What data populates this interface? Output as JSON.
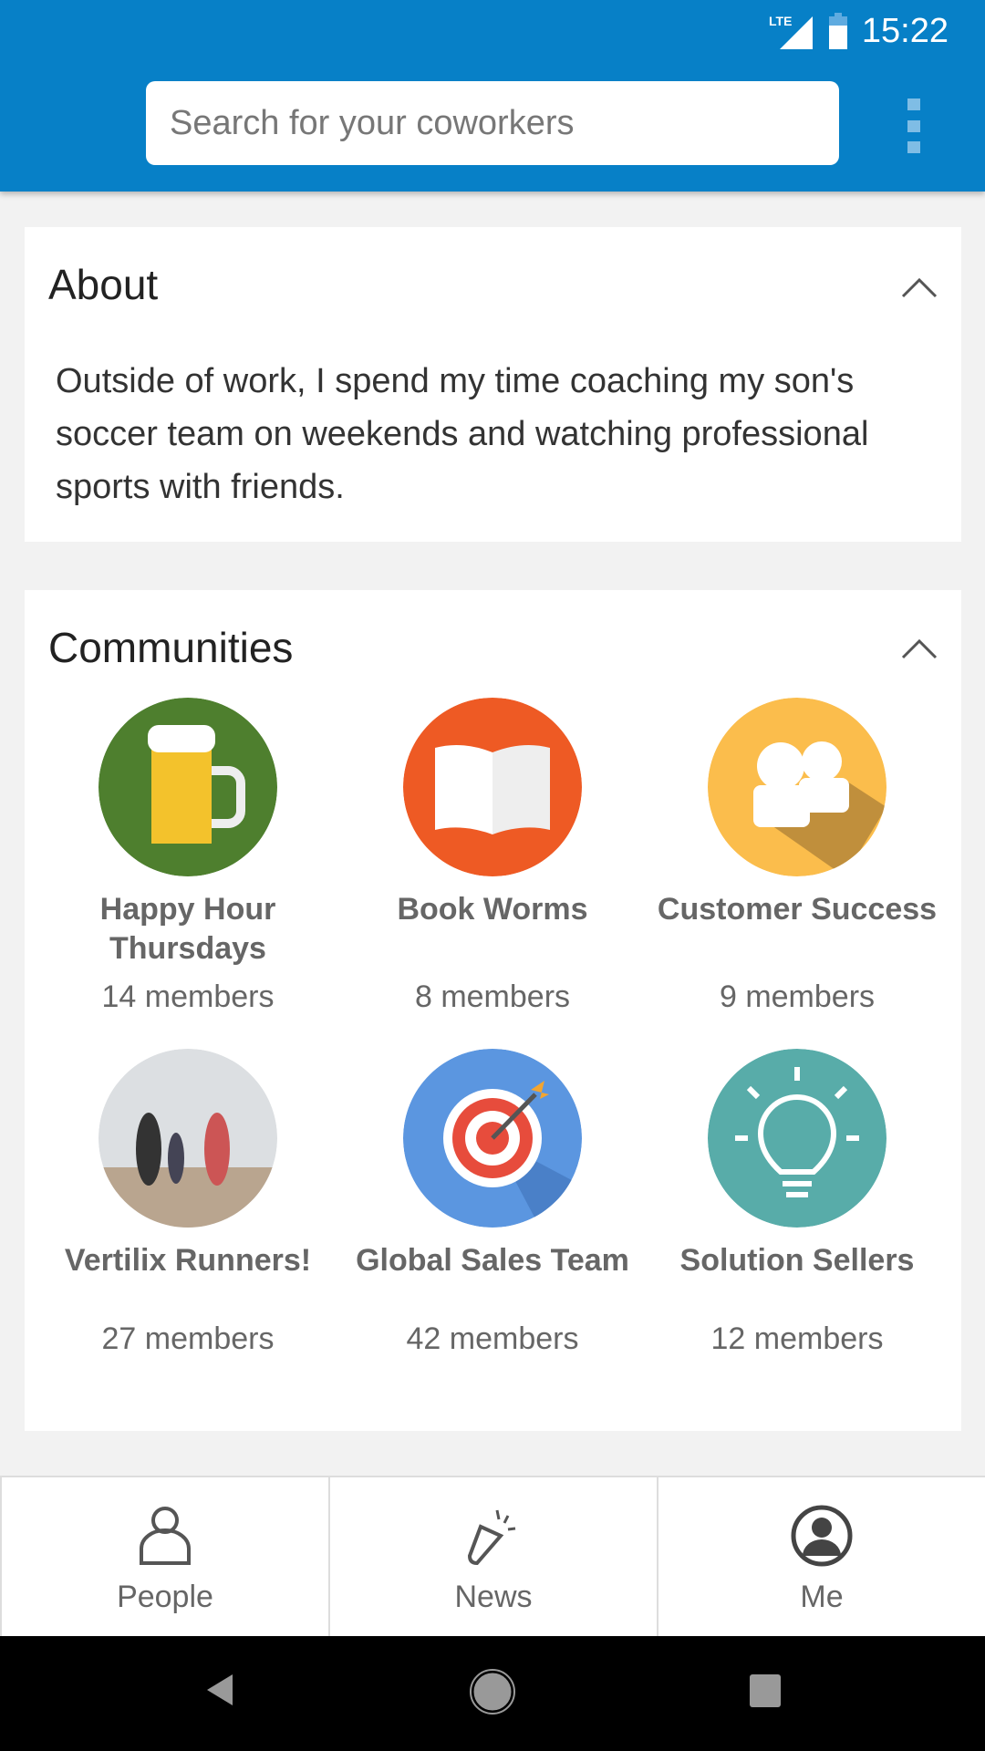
{
  "status_bar": {
    "network": "LTE",
    "time": "15:22"
  },
  "header": {
    "search_placeholder": "Search for your coworkers",
    "menu_icon": "kebab-menu-icon"
  },
  "about": {
    "title": "About",
    "text": "Outside of work, I spend my time coaching my son's soccer team on weekends and watching professional sports with friends."
  },
  "communities": {
    "title": "Communities",
    "items": [
      {
        "name": "Happy Hour Thursdays",
        "members": "14 members",
        "icon": "beer-mug-icon",
        "color": "#4e7f2e"
      },
      {
        "name": "Book Worms",
        "members": "8 members",
        "icon": "open-book-icon",
        "color": "#ee5a24"
      },
      {
        "name": "Customer Success",
        "members": "9 members",
        "icon": "people-icon",
        "color": "#fbbd4c"
      },
      {
        "name": "Vertilix Runners!",
        "members": "27 members",
        "icon": "runners-photo",
        "color": "#c9cdd0"
      },
      {
        "name": "Global Sales Team",
        "members": "42 members",
        "icon": "target-icon",
        "color": "#5b96e0"
      },
      {
        "name": "Solution Sellers",
        "members": "12 members",
        "icon": "lightbulb-icon",
        "color": "#58aca9"
      }
    ]
  },
  "bottom_nav": [
    {
      "label": "People",
      "icon": "person-outline-icon"
    },
    {
      "label": "News",
      "icon": "flashlight-icon"
    },
    {
      "label": "Me",
      "icon": "account-circle-icon"
    }
  ],
  "colors": {
    "header": "#0780c7",
    "background": "#f2f2f2"
  }
}
